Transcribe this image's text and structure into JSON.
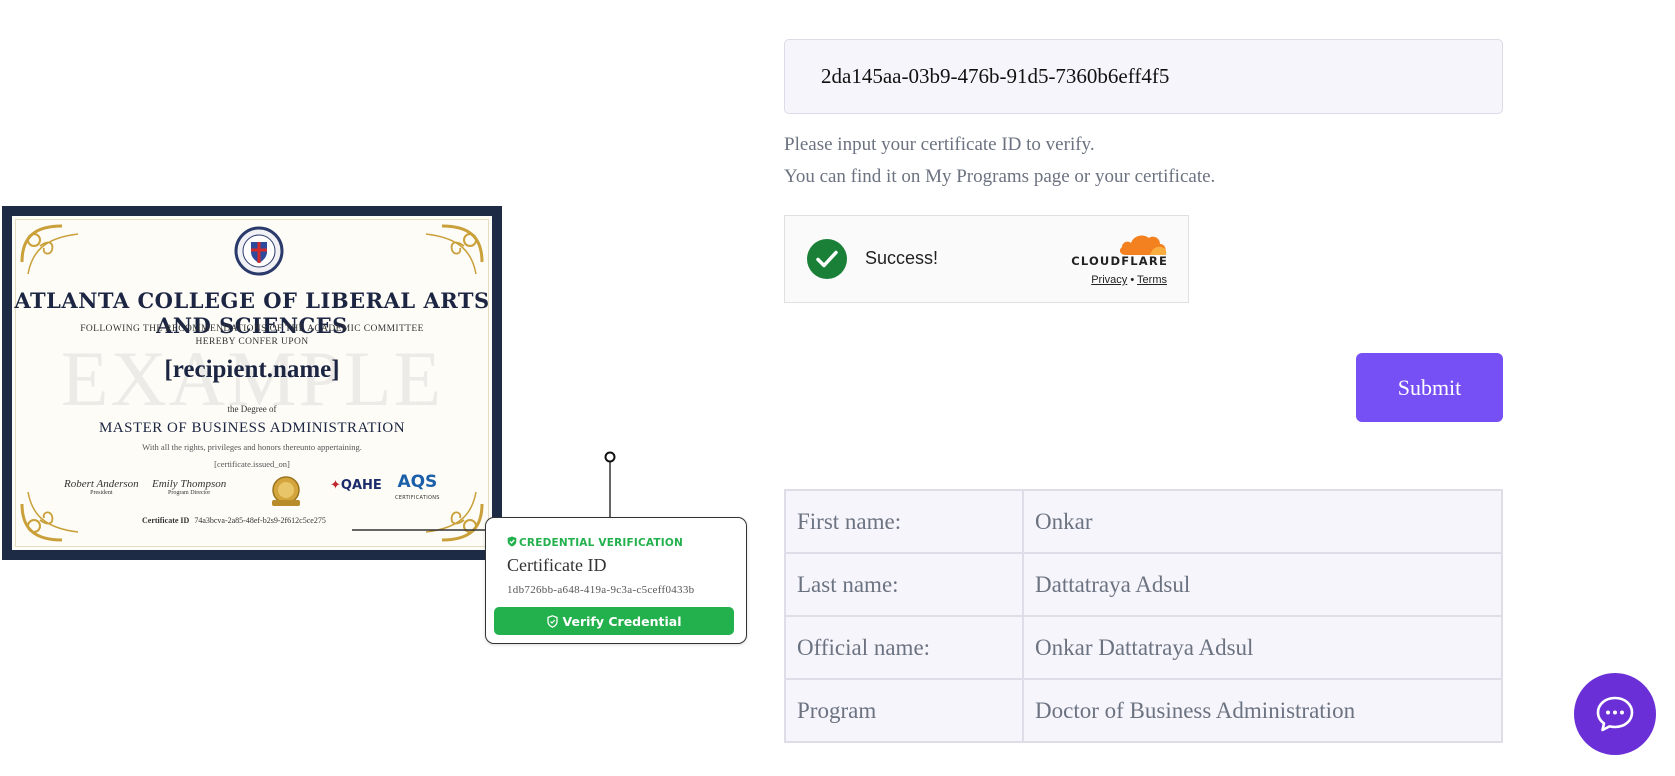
{
  "certificate": {
    "college_name": "ATLANTA COLLEGE OF LIBERAL ARTS AND SCIENCES",
    "recommendation_line": "FOLLOWING THE RECOMMENDATIONS OF THE ACADEMIC COMMITTEE",
    "confer_line": "HEREBY CONFER UPON",
    "watermark": "EXAMPLE",
    "recipient": "[recipient.name]",
    "degree_intro": "the Degree of",
    "degree": "MASTER OF BUSINESS ADMINISTRATION",
    "rights_line": "With all the rights, privileges and honors thereunto appertaining.",
    "issued_on": "[certificate.issued_on]",
    "signatures": [
      {
        "name": "Robert Anderson",
        "role": "President"
      },
      {
        "name": "Emily Thompson",
        "role": "Program Director"
      }
    ],
    "accreditor_qahe": "QAHE",
    "accreditor_aqs": "AQS",
    "accreditor_aqs_sub": "CERTIFICATIONS",
    "certificate_id_label": "Certificate ID",
    "certificate_id": "74a3bcva-2a85-48ef-b2s9-2f612c5ce275"
  },
  "verify_card": {
    "heading": "CREDENTIAL VERIFICATION",
    "label": "Certificate ID",
    "id": "1db726bb-a648-419a-9c3a-c5ceff0433b",
    "button": "Verify Credential",
    "accent_color": "#22b14c"
  },
  "form": {
    "certificate_id_value": "2da145aa-03b9-476b-91d5-7360b6eff4f5",
    "help_line_1": "Please input your certificate ID to verify.",
    "help_line_2": "You can find it on My Programs page or your certificate.",
    "submit_label": "Submit",
    "accent_color": "#7650f5"
  },
  "captcha": {
    "status": "Success!",
    "provider": "CLOUDFLARE",
    "privacy_link": "Privacy",
    "separator": "•",
    "terms_link": "Terms"
  },
  "result": {
    "rows": [
      {
        "label": "First name:",
        "value": "Onkar"
      },
      {
        "label": "Last name:",
        "value": "Dattatraya Adsul"
      },
      {
        "label": "Official name:",
        "value": "Onkar Dattatraya Adsul"
      },
      {
        "label": "Program",
        "value": "Doctor of Business Administration"
      }
    ]
  },
  "chat": {
    "icon": "chat-bubble-icon",
    "color": "#6a2fd6"
  }
}
